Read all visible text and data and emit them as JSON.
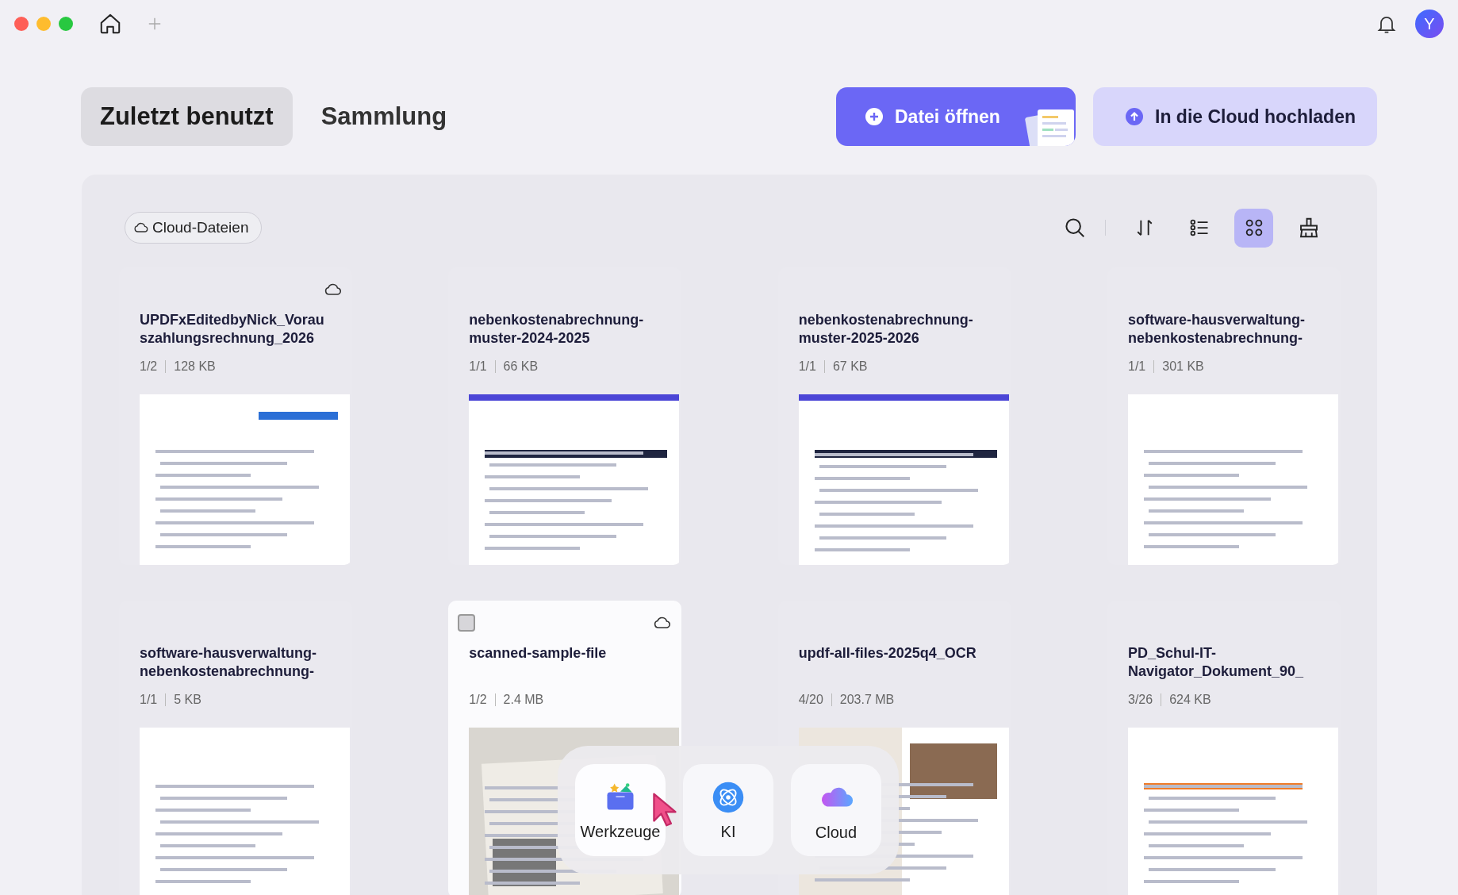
{
  "titlebar": {
    "avatar": "Y"
  },
  "tabs": [
    {
      "label": "Zuletzt benutzt",
      "selected": true
    },
    {
      "label": "Sammlung",
      "selected": false
    }
  ],
  "actions": [
    {
      "kind": "open",
      "label": "Datei öffnen"
    },
    {
      "kind": "upload",
      "label": "In die Cloud hochladen"
    }
  ],
  "filter_chip": "Cloud-Dateien",
  "view_tools": [
    {
      "kind": "search",
      "selected": false
    },
    {
      "kind": "sort",
      "selected": false
    },
    {
      "kind": "list",
      "selected": false
    },
    {
      "kind": "grid",
      "selected": true
    },
    {
      "kind": "clean",
      "selected": false
    }
  ],
  "files": [
    {
      "name": "UPDFxEditedbyNick_Vorauszahlungsrechnung_2026",
      "pages": "1/2",
      "size": "128 KB",
      "cloud": true,
      "hovered": false
    },
    {
      "name": "nebenkostenabrechnung-muster-2024-2025",
      "pages": "1/1",
      "size": "66 KB",
      "cloud": false,
      "hovered": false
    },
    {
      "name": "nebenkostenabrechnung-muster-2025-2026",
      "pages": "1/1",
      "size": "67 KB",
      "cloud": false,
      "hovered": false
    },
    {
      "name": "software-hausverwaltung-nebenkostenabrechnung-",
      "pages": "1/1",
      "size": "301 KB",
      "cloud": false,
      "hovered": false
    },
    {
      "name": "software-hausverwaltung-nebenkostenabrechnung-",
      "pages": "1/1",
      "size": "5 KB",
      "cloud": false,
      "hovered": false
    },
    {
      "name": "scanned-sample-file",
      "pages": "1/2",
      "size": "2.4 MB",
      "cloud": true,
      "hovered": true,
      "checked": false
    },
    {
      "name": "updf-all-files-2025q4_OCR",
      "pages": "4/20",
      "size": "203.7 MB",
      "cloud": false,
      "hovered": false
    },
    {
      "name": "PD_Schul-IT-Navigator_Dokument_90_",
      "pages": "3/26",
      "size": "624 KB",
      "cloud": false,
      "hovered": false
    }
  ],
  "dock": [
    {
      "kind": "tools",
      "label": "Werkzeuge"
    },
    {
      "kind": "ai",
      "label": "KI"
    },
    {
      "kind": "cloud",
      "label": "Cloud"
    }
  ]
}
